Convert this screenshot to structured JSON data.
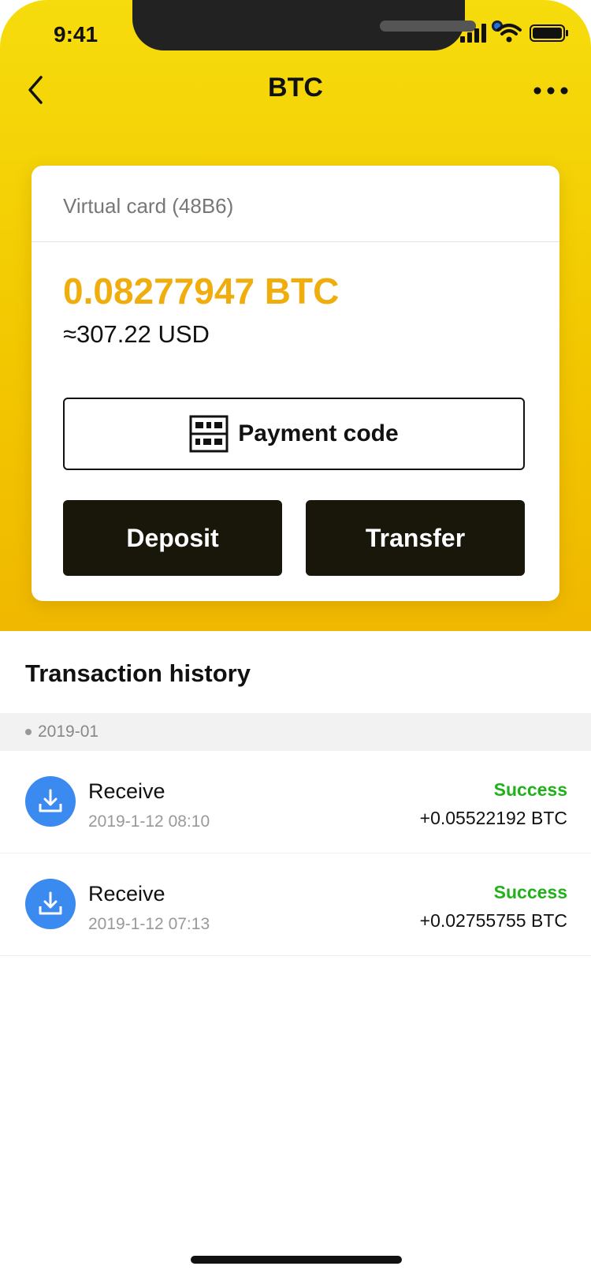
{
  "status_bar": {
    "time": "9:41"
  },
  "nav": {
    "title": "BTC"
  },
  "card": {
    "title": "Virtual card (48B6)",
    "btc_amount": "0.08277947 BTC",
    "usd_amount": "≈307.22 USD",
    "payment_code_label": "Payment code",
    "deposit_label": "Deposit",
    "transfer_label": "Transfer"
  },
  "history": {
    "title": "Transaction history",
    "month": "2019-01",
    "transactions": [
      {
        "type": "Receive",
        "date": "2019-1-12 08:10",
        "status": "Success",
        "amount": "+0.05522192 BTC"
      },
      {
        "type": "Receive",
        "date": "2019-1-12 07:13",
        "status": "Success",
        "amount": "+0.02755755 BTC"
      }
    ]
  },
  "colors": {
    "accent_yellow": "#f2c600",
    "amount_orange": "#f0ad0e",
    "success_green": "#21b11a",
    "icon_blue": "#3a8af0",
    "button_dark": "#19170a"
  }
}
